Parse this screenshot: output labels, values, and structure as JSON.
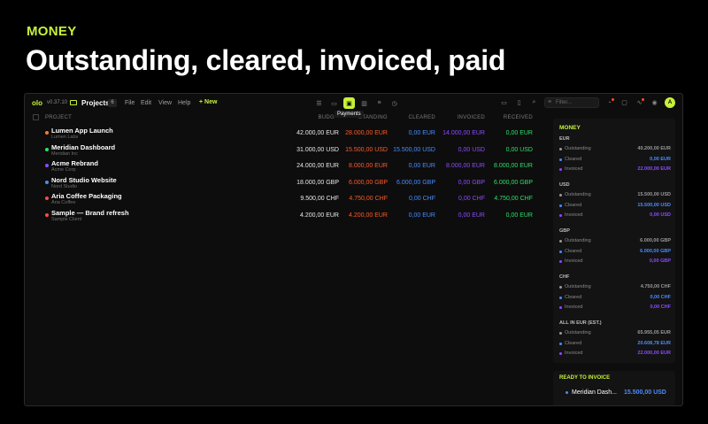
{
  "hero": {
    "kicker": "MONEY",
    "title": "Outstanding, cleared, invoiced, paid"
  },
  "toolbar": {
    "logo": "olo",
    "version": "v0.37.10",
    "breadcrumb": "Projects",
    "count": "6",
    "menu": [
      "File",
      "Edit",
      "View",
      "Help"
    ],
    "new_label": "+ New",
    "tooltip": "Payments",
    "filter_placeholder": "Filter...",
    "avatar": "A"
  },
  "table": {
    "headers": {
      "project": "PROJECT",
      "budget": "BUDG",
      "outstanding": "STANDING",
      "cleared": "CLEARED",
      "invoiced": "INVOICED",
      "received": "RECEIVED"
    },
    "rows": [
      {
        "name": "Lumen App Launch",
        "client": "Lumen Labs",
        "dot": "#ff7a2a",
        "budget": "42.000,00 EUR",
        "outstanding": "28.000,00 EUR",
        "cleared": "0,00 EUR",
        "invoiced": "14.000,00 EUR",
        "received": "0,00 EUR"
      },
      {
        "name": "Meridian Dashboard",
        "client": "Meridian Inc",
        "dot": "#2ee06a",
        "budget": "31.000,00 USD",
        "outstanding": "15.500,00 USD",
        "cleared": "15.500,00 USD",
        "invoiced": "0,00 USD",
        "received": "0,00 USD"
      },
      {
        "name": "Acme Rebrand",
        "client": "Acme Corp",
        "dot": "#8a4cff",
        "budget": "24.000,00 EUR",
        "outstanding": "8.000,00 EUR",
        "cleared": "0,00 EUR",
        "invoiced": "8.000,00 EUR",
        "received": "8.000,00 EUR"
      },
      {
        "name": "Nord Studio Website",
        "client": "Nord Studio",
        "dot": "#4a8cff",
        "budget": "18.000,00 GBP",
        "outstanding": "6.000,00 GBP",
        "cleared": "6.000,00 GBP",
        "invoiced": "0,00 GBP",
        "received": "6.000,00 GBP"
      },
      {
        "name": "Aria Coffee Packaging",
        "client": "Aria Coffee",
        "dot": "#ff4a4a",
        "budget": "9.500,00 CHF",
        "outstanding": "4.750,00 CHF",
        "cleared": "0,00 CHF",
        "invoiced": "0,00 CHF",
        "received": "4.750,00 CHF"
      },
      {
        "name": "Sample — Brand refresh",
        "client": "Sample Client",
        "dot": "#ff4a4a",
        "budget": "4.200,00 EUR",
        "outstanding": "4.200,00 EUR",
        "cleared": "0,00 EUR",
        "invoiced": "0,00 EUR",
        "received": "0,00 EUR"
      }
    ]
  },
  "money_panel": {
    "title": "MONEY",
    "groups": [
      {
        "currency": "EUR",
        "outstanding": "40.200,00 EUR",
        "cleared": "0,00 EUR",
        "invoiced": "22.000,00 EUR"
      },
      {
        "currency": "USD",
        "outstanding": "15.500,00 USD",
        "cleared": "15.500,00 USD",
        "invoiced": "0,00 USD"
      },
      {
        "currency": "GBP",
        "outstanding": "6.000,00 GBP",
        "cleared": "6.000,00 GBP",
        "invoiced": "0,00 GBP"
      },
      {
        "currency": "CHF",
        "outstanding": "4.750,00 CHF",
        "cleared": "0,00 CHF",
        "invoiced": "0,00 CHF"
      },
      {
        "currency": "ALL IN EUR (EST.)",
        "outstanding": "65.955,05 EUR",
        "cleared": "20.608,78 EUR",
        "invoiced": "22.000,00 EUR"
      }
    ],
    "labels": {
      "outstanding": "Outstanding",
      "cleared": "Cleared",
      "invoiced": "Invoiced"
    }
  },
  "ready": {
    "title": "READY TO INVOICE",
    "name": "Meridian Dash...",
    "amount": "15.500,00 USD"
  },
  "colors": {
    "accent": "#c6f23a",
    "outstanding": "#ff5a2a",
    "cleared": "#4a8cff",
    "invoiced": "#8a4cff",
    "received": "#2ee06a"
  }
}
